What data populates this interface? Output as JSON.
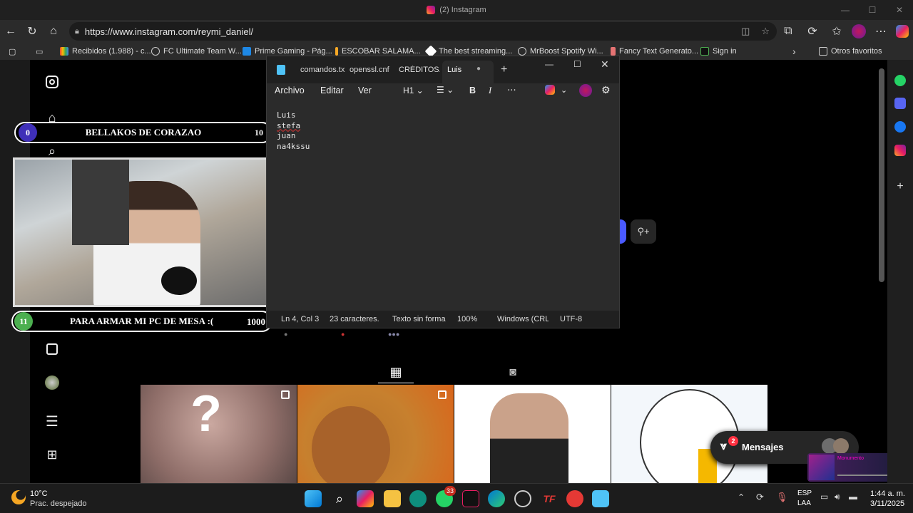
{
  "window": {
    "title": "(2) Instagram"
  },
  "browser": {
    "url": "https://www.instagram.com/reymi_daniel/",
    "bookmarks": [
      "Recibidos (1.988) - c...",
      "FC Ultimate Team W...",
      "Prime Gaming - Pág...",
      "ESCOBAR SALAMA...",
      "The best streaming...",
      "MrBoost Spotify Wi...",
      "Fancy Text Generato...",
      "Sign in"
    ],
    "other_favorites": "Otros favoritos"
  },
  "overlay": {
    "top_bar": {
      "left_num": "0",
      "title": "BELLAKOS DE CORAZAO",
      "right_num": "10"
    },
    "bottom_bar": {
      "left_num": "11",
      "title": "PARA ARMAR MI PC DE MESA :(",
      "right_num": "1000"
    }
  },
  "notepad": {
    "tabs": [
      "comandos.tx",
      "openssl.cnf",
      "CRÉDITOS.txt",
      "Luis"
    ],
    "menu": [
      "Archivo",
      "Editar",
      "Ver"
    ],
    "heading": "H1",
    "lines": [
      "Luis",
      "stefa",
      "juan",
      "na4kssu"
    ],
    "status": {
      "position": "Ln 4, Col 3",
      "chars": "23 caracteres.",
      "format": "Texto sin forma",
      "zoom": "100%",
      "eol": "Windows (CRLF)",
      "encoding": "UTF-8"
    }
  },
  "messages": {
    "label": "Mensajes",
    "badge": "2"
  },
  "mini_player": {
    "title": "Monumento"
  },
  "taskbar": {
    "weather_temp": "10°C",
    "weather_desc": "Prac. despejado",
    "whatsapp_badge": "33",
    "lang_top": "ESP",
    "lang_bottom": "LAA",
    "time": "1:44 a. m.",
    "date": "3/11/2025"
  }
}
